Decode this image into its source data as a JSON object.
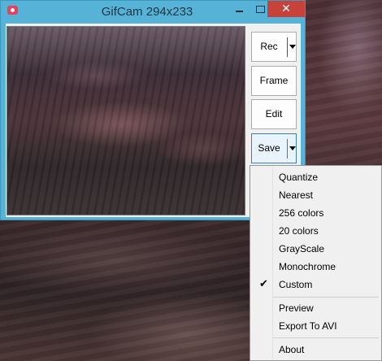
{
  "window": {
    "title": "GifCam 294x233",
    "controls": {
      "minimize": "",
      "maximize": "",
      "close": "✕"
    }
  },
  "buttons": {
    "rec": "Rec",
    "frame": "Frame",
    "edit": "Edit",
    "save": "Save"
  },
  "save_menu": {
    "items": [
      {
        "label": "Quantize",
        "checked": false
      },
      {
        "label": "Nearest",
        "checked": false
      },
      {
        "label": "256 colors",
        "checked": false
      },
      {
        "label": "20 colors",
        "checked": false
      },
      {
        "label": "GrayScale",
        "checked": false
      },
      {
        "label": "Monochrome",
        "checked": false
      },
      {
        "label": "Custom",
        "checked": true
      },
      {
        "label": "Preview",
        "checked": false
      },
      {
        "label": "Export To AVI",
        "checked": false
      },
      {
        "label": "About",
        "checked": false
      }
    ],
    "check_glyph": "✔"
  },
  "colors": {
    "window_frame": "#56b2d6",
    "close_button": "#c7423a",
    "app_icon": "#e8405b"
  }
}
